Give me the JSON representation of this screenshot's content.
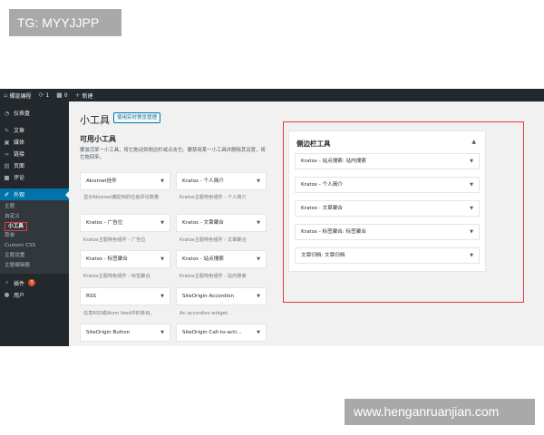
{
  "overlay": {
    "tag": "TG: MYYJJPP",
    "site": "www.henganruanjian.com"
  },
  "adminbar": {
    "site_name": "螺旋编程",
    "updates": "1",
    "comments": "0",
    "new_label": "新建"
  },
  "sidebar": {
    "dashboard": "仪表盘",
    "posts": "文章",
    "media": "媒体",
    "links": "链接",
    "pages": "页面",
    "comments": "评论",
    "appearance": "外观",
    "sub": [
      "主题",
      "自定义",
      "小工具",
      "菜单",
      "Custom CSS",
      "主题设置",
      "主题编辑器"
    ],
    "plugins": "插件",
    "plugins_badge": "3",
    "users": "用户"
  },
  "main": {
    "title": "小工具",
    "manage_btn": "使用实时预览管理",
    "available_title": "可用小工具",
    "available_desc": "要激活某一小工具，将它拖动到侧边栏或点击它。要禁用某一小工具并删除其设置，将它拖回来。"
  },
  "widgets": [
    {
      "name": "Akismet挂件",
      "desc": "显示Akismet捕捉到的垃圾评论数量"
    },
    {
      "name": "Kratos - 个人简介",
      "desc": "Kratos主题特色组件 - 个人简介"
    },
    {
      "name": "Kratos - 广告位",
      "desc": "Kratos主题特色组件 - 广告位"
    },
    {
      "name": "Kratos - 文章聚合",
      "desc": "Kratos主题特色组件 - 文章聚合"
    },
    {
      "name": "Kratos - 标签聚合",
      "desc": "Kratos主题特色组件 - 标签聚合"
    },
    {
      "name": "Kratos - 站点搜索",
      "desc": "Kratos主题特色组件 - 站内搜索"
    },
    {
      "name": "RSS",
      "desc": "任意RSS或Atom feed中的条目。"
    },
    {
      "name": "SiteOrigin Accordion",
      "desc": "An accordion widget."
    },
    {
      "name": "SiteOrigin Button",
      "desc": ""
    },
    {
      "name": "SiteOrigin Call-to-acti...",
      "desc": ""
    }
  ],
  "sidebar_area": {
    "title": "侧边栏工具",
    "widgets": [
      "Kratos - 站点搜索: 站内搜索",
      "Kratos - 个人简介",
      "Kratos - 文章聚合",
      "Kratos - 标签聚合: 标签聚合",
      "文章归档: 文章归档"
    ]
  }
}
